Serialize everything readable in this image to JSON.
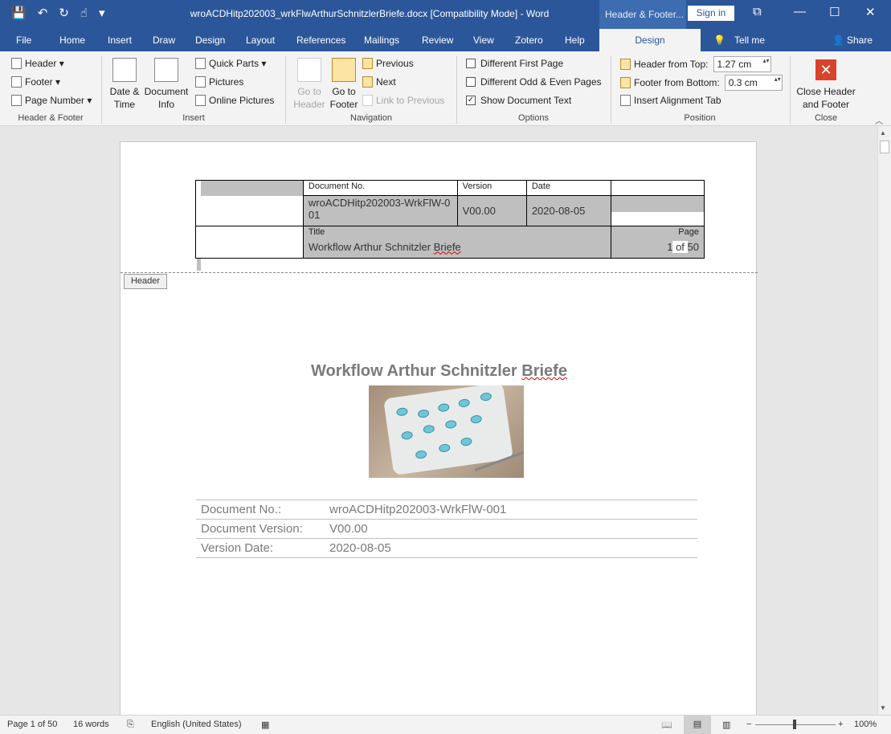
{
  "window": {
    "title": "wroACDHitp202003_wrkFlwArthurSchnitzlerBriefe.docx [Compatibility Mode]  -  Word",
    "context_tab_group": "Header & Footer...",
    "sign_in": "Sign in",
    "controls": [
      "⧉",
      "—",
      "☐",
      "✕"
    ]
  },
  "qat": {
    "save": "💾",
    "undo": "↶",
    "redo": "↻",
    "touch": "☝",
    "more": "▾"
  },
  "tabs": [
    "File",
    "Home",
    "Insert",
    "Draw",
    "Design",
    "Layout",
    "References",
    "Mailings",
    "Review",
    "View",
    "Zotero",
    "Help"
  ],
  "active_tab": "Design",
  "tell_me": "Tell me",
  "share": "Share",
  "ribbon": {
    "header_footer": {
      "label": "Header & Footer",
      "header": "Header",
      "footer": "Footer",
      "page_number": "Page Number"
    },
    "insert": {
      "label": "Insert",
      "date_time": "Date &\nTime",
      "doc_info": "Document\nInfo",
      "quick_parts": "Quick Parts",
      "pictures": "Pictures",
      "online_pictures": "Online Pictures"
    },
    "navigation": {
      "label": "Navigation",
      "go_header": "Go to\nHeader",
      "go_footer": "Go to\nFooter",
      "previous": "Previous",
      "next": "Next",
      "link_previous": "Link to Previous"
    },
    "options": {
      "label": "Options",
      "diff_first": "Different First Page",
      "diff_odd_even": "Different Odd & Even Pages",
      "show_doc_text": "Show Document Text",
      "diff_first_checked": false,
      "diff_odd_even_checked": false,
      "show_doc_text_checked": true
    },
    "position": {
      "label": "Position",
      "header_from_top": "Header from Top:",
      "header_value": "1.27 cm",
      "footer_from_bottom": "Footer from Bottom:",
      "footer_value": "0.3 cm",
      "insert_alignment_tab": "Insert Alignment Tab"
    },
    "close": {
      "label": "Close",
      "button": "Close Header\nand Footer"
    }
  },
  "header_table": {
    "doc_no_label": "Document No.",
    "doc_no_value": "wroACDHitp202003-WrkFlW-001",
    "version_label": "Version",
    "version_value": "V00.00",
    "date_label": "Date",
    "date_value": "2020-08-05",
    "title_label": "Title",
    "title_value_a": "Workflow Arthur Schnitzler ",
    "title_value_b": "Briefe",
    "page_label": "Page",
    "page_current": "1",
    "page_of": " of ",
    "page_total": "50"
  },
  "header_tag": "Header",
  "cover": {
    "title_a": "Workflow Arthur Schnitzler ",
    "title_b": "Briefe",
    "rows": [
      {
        "label": "Document No.:",
        "value": "wroACDHitp202003-WrkFlW-001"
      },
      {
        "label": "Document Version:",
        "value": "V00.00"
      },
      {
        "label": "Version Date:",
        "value": "2020-08-05"
      }
    ]
  },
  "status": {
    "page": "Page 1 of 50",
    "words": "16 words",
    "language": "English (United States)",
    "zoom": "100%",
    "zoom_minus": "−",
    "zoom_plus": "+"
  }
}
